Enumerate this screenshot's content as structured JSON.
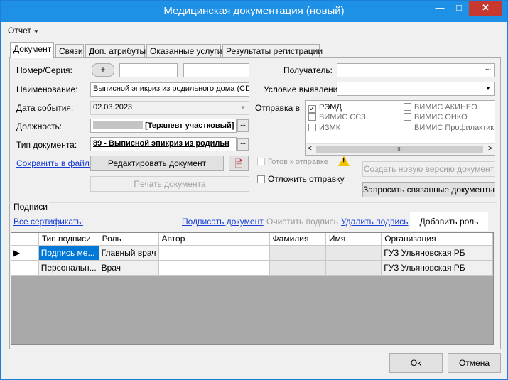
{
  "window": {
    "title": "Медицинская документация (новый)",
    "minimize_glyph": "—",
    "maximize_glyph": "□",
    "close_glyph": "✕"
  },
  "menu": {
    "report_label": "Отчет"
  },
  "tabs": [
    {
      "label": "Документ"
    },
    {
      "label": "Связи"
    },
    {
      "label": "Доп. атрибуты"
    },
    {
      "label": "Оказанные услуги"
    },
    {
      "label": "Результаты регистрации"
    }
  ],
  "form": {
    "number_label": "Номер/Серия:",
    "plus_label": "+",
    "number_value": "",
    "series_value": "",
    "name_label": "Наименование:",
    "name_value": "Выписной эпикриз из родильного дома (CD",
    "event_date_label": "Дата события:",
    "event_date_value": "02.03.2023",
    "position_label": "Должность:",
    "position_value": "[Терапевт участковый]",
    "doctype_label": "Тип документа:",
    "doctype_value": "89 - Выписной эпикриз из родильн",
    "recipient_label": "Получатель:",
    "recipient_value": "",
    "condition_label": "Условие выявления:",
    "condition_value": "",
    "send_to_label": "Отправка в",
    "ellipsis": "...",
    "dropdown_glyph": "▼"
  },
  "send_targets": [
    {
      "label": "РЭМД",
      "checked": true
    },
    {
      "label": "ВИМИС ССЗ",
      "checked": false
    },
    {
      "label": "ИЗМК",
      "checked": false
    },
    {
      "label": "ВИМИС АКИНЕО",
      "checked": false
    },
    {
      "label": "ВИМИС ОНКО",
      "checked": false
    },
    {
      "label": "ВИМИС Профилактик",
      "checked": false
    }
  ],
  "scroll": {
    "left": "<",
    "right": ">",
    "thumb": "III"
  },
  "actions": {
    "save_to_file": "Сохранить в файл",
    "edit_document": "Редактировать документ",
    "print_document": "Печать документа",
    "ready_to_send": "Готов к отправке",
    "postpone_send": "Отложить отправку",
    "create_new_version": "Создать новую версию документ",
    "request_linked": "Запросить связанные документы",
    "warning_glyph": "!"
  },
  "signatures": {
    "group_label": "Подписи",
    "all_certs": "Все сертификаты",
    "sign_document": "Подписать документ",
    "clear_signature": "Очистить подпись",
    "delete_signature": "Удалить подпись",
    "add_role": "Добавить роль",
    "columns": [
      "Тип подписи",
      "Роль",
      "Автор",
      "Фамилия",
      "Имя",
      "Организация"
    ],
    "rows": [
      {
        "marker": "▶",
        "type": "Подпись ме...",
        "role": "Главный врач",
        "author": "",
        "surname": "",
        "name": "",
        "org": "ГУЗ Ульяновская РБ"
      },
      {
        "marker": "",
        "type": "Персональн...",
        "role": "Врач",
        "author": "",
        "surname": "",
        "name": "",
        "org": "ГУЗ Ульяновская РБ"
      }
    ]
  },
  "footer": {
    "ok": "Ok",
    "cancel": "Отмена"
  }
}
